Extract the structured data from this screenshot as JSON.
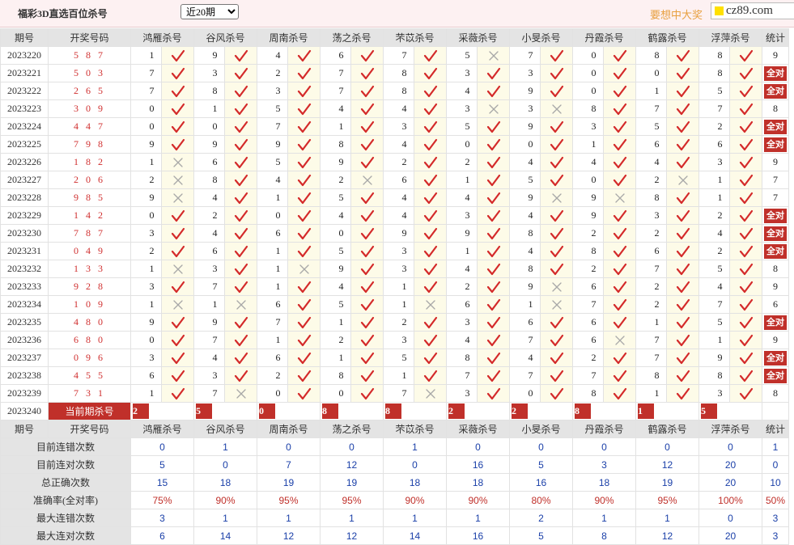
{
  "header": {
    "title": "福彩3D直选百位杀号",
    "period_selected": "近20期",
    "period_options": [
      "近20期"
    ],
    "slogan": "要想中大奖",
    "site": "cz89.com"
  },
  "table": {
    "col_issue": "期号",
    "col_draw": "开奖号码",
    "col_stat": "统计",
    "experts": [
      "鸿雁杀号",
      "谷风杀号",
      "周南杀号",
      "荡之杀号",
      "芣苡杀号",
      "采薇杀号",
      "小旻杀号",
      "丹霞杀号",
      "鹤露杀号",
      "浮萍杀号"
    ],
    "all_correct_text": "全对",
    "rows": [
      {
        "issue": "2023220",
        "draw": "587",
        "cells": [
          [
            1,
            1
          ],
          [
            9,
            1
          ],
          [
            4,
            1
          ],
          [
            6,
            1
          ],
          [
            7,
            1
          ],
          [
            5,
            0
          ],
          [
            7,
            1
          ],
          [
            0,
            1
          ],
          [
            8,
            1
          ],
          [
            8,
            1
          ]
        ],
        "stat": "9"
      },
      {
        "issue": "2023221",
        "draw": "503",
        "cells": [
          [
            7,
            1
          ],
          [
            3,
            1
          ],
          [
            2,
            1
          ],
          [
            7,
            1
          ],
          [
            8,
            1
          ],
          [
            3,
            1
          ],
          [
            3,
            1
          ],
          [
            0,
            1
          ],
          [
            0,
            1
          ],
          [
            8,
            1
          ]
        ],
        "stat": "全对"
      },
      {
        "issue": "2023222",
        "draw": "265",
        "cells": [
          [
            7,
            1
          ],
          [
            8,
            1
          ],
          [
            3,
            1
          ],
          [
            7,
            1
          ],
          [
            8,
            1
          ],
          [
            4,
            1
          ],
          [
            9,
            1
          ],
          [
            0,
            1
          ],
          [
            1,
            1
          ],
          [
            5,
            1
          ]
        ],
        "stat": "全对"
      },
      {
        "issue": "2023223",
        "draw": "309",
        "cells": [
          [
            0,
            1
          ],
          [
            1,
            1
          ],
          [
            5,
            1
          ],
          [
            4,
            1
          ],
          [
            4,
            1
          ],
          [
            3,
            0
          ],
          [
            3,
            0
          ],
          [
            8,
            1
          ],
          [
            7,
            1
          ],
          [
            7,
            1
          ]
        ],
        "stat": "8"
      },
      {
        "issue": "2023224",
        "draw": "447",
        "cells": [
          [
            0,
            1
          ],
          [
            0,
            1
          ],
          [
            7,
            1
          ],
          [
            1,
            1
          ],
          [
            3,
            1
          ],
          [
            5,
            1
          ],
          [
            9,
            1
          ],
          [
            3,
            1
          ],
          [
            5,
            1
          ],
          [
            2,
            1
          ]
        ],
        "stat": "全对"
      },
      {
        "issue": "2023225",
        "draw": "798",
        "cells": [
          [
            9,
            1
          ],
          [
            9,
            1
          ],
          [
            9,
            1
          ],
          [
            8,
            1
          ],
          [
            4,
            1
          ],
          [
            0,
            1
          ],
          [
            0,
            1
          ],
          [
            1,
            1
          ],
          [
            6,
            1
          ],
          [
            6,
            1
          ]
        ],
        "stat": "全对"
      },
      {
        "issue": "2023226",
        "draw": "182",
        "cells": [
          [
            1,
            0
          ],
          [
            6,
            1
          ],
          [
            5,
            1
          ],
          [
            9,
            1
          ],
          [
            2,
            1
          ],
          [
            2,
            1
          ],
          [
            4,
            1
          ],
          [
            4,
            1
          ],
          [
            4,
            1
          ],
          [
            3,
            1
          ]
        ],
        "stat": "9"
      },
      {
        "issue": "2023227",
        "draw": "206",
        "cells": [
          [
            2,
            0
          ],
          [
            8,
            1
          ],
          [
            4,
            1
          ],
          [
            2,
            0
          ],
          [
            6,
            1
          ],
          [
            1,
            1
          ],
          [
            5,
            1
          ],
          [
            0,
            1
          ],
          [
            2,
            0
          ],
          [
            1,
            1
          ]
        ],
        "stat": "7"
      },
      {
        "issue": "2023228",
        "draw": "985",
        "cells": [
          [
            9,
            0
          ],
          [
            4,
            1
          ],
          [
            1,
            1
          ],
          [
            5,
            1
          ],
          [
            4,
            1
          ],
          [
            4,
            1
          ],
          [
            9,
            0
          ],
          [
            9,
            0
          ],
          [
            8,
            1
          ],
          [
            1,
            1
          ]
        ],
        "stat": "7"
      },
      {
        "issue": "2023229",
        "draw": "142",
        "cells": [
          [
            0,
            1
          ],
          [
            2,
            1
          ],
          [
            0,
            1
          ],
          [
            4,
            1
          ],
          [
            4,
            1
          ],
          [
            3,
            1
          ],
          [
            4,
            1
          ],
          [
            9,
            1
          ],
          [
            3,
            1
          ],
          [
            2,
            1
          ]
        ],
        "stat": "全对"
      },
      {
        "issue": "2023230",
        "draw": "787",
        "cells": [
          [
            3,
            1
          ],
          [
            4,
            1
          ],
          [
            6,
            1
          ],
          [
            0,
            1
          ],
          [
            9,
            1
          ],
          [
            9,
            1
          ],
          [
            8,
            1
          ],
          [
            2,
            1
          ],
          [
            2,
            1
          ],
          [
            4,
            1
          ]
        ],
        "stat": "全对"
      },
      {
        "issue": "2023231",
        "draw": "049",
        "cells": [
          [
            2,
            1
          ],
          [
            6,
            1
          ],
          [
            1,
            1
          ],
          [
            5,
            1
          ],
          [
            3,
            1
          ],
          [
            1,
            1
          ],
          [
            4,
            1
          ],
          [
            8,
            1
          ],
          [
            6,
            1
          ],
          [
            2,
            1
          ]
        ],
        "stat": "全对"
      },
      {
        "issue": "2023232",
        "draw": "133",
        "cells": [
          [
            1,
            0
          ],
          [
            3,
            1
          ],
          [
            1,
            0
          ],
          [
            9,
            1
          ],
          [
            3,
            1
          ],
          [
            4,
            1
          ],
          [
            8,
            1
          ],
          [
            2,
            1
          ],
          [
            7,
            1
          ],
          [
            5,
            1
          ]
        ],
        "stat": "8"
      },
      {
        "issue": "2023233",
        "draw": "928",
        "cells": [
          [
            3,
            1
          ],
          [
            7,
            1
          ],
          [
            1,
            1
          ],
          [
            4,
            1
          ],
          [
            1,
            1
          ],
          [
            2,
            1
          ],
          [
            9,
            0
          ],
          [
            6,
            1
          ],
          [
            2,
            1
          ],
          [
            4,
            1
          ]
        ],
        "stat": "9"
      },
      {
        "issue": "2023234",
        "draw": "109",
        "cells": [
          [
            1,
            0
          ],
          [
            1,
            0
          ],
          [
            6,
            1
          ],
          [
            5,
            1
          ],
          [
            1,
            0
          ],
          [
            6,
            1
          ],
          [
            1,
            0
          ],
          [
            7,
            1
          ],
          [
            2,
            1
          ],
          [
            7,
            1
          ]
        ],
        "stat": "6"
      },
      {
        "issue": "2023235",
        "draw": "480",
        "cells": [
          [
            9,
            1
          ],
          [
            9,
            1
          ],
          [
            7,
            1
          ],
          [
            1,
            1
          ],
          [
            2,
            1
          ],
          [
            3,
            1
          ],
          [
            6,
            1
          ],
          [
            6,
            1
          ],
          [
            1,
            1
          ],
          [
            5,
            1
          ]
        ],
        "stat": "全对"
      },
      {
        "issue": "2023236",
        "draw": "680",
        "cells": [
          [
            0,
            1
          ],
          [
            7,
            1
          ],
          [
            1,
            1
          ],
          [
            2,
            1
          ],
          [
            3,
            1
          ],
          [
            4,
            1
          ],
          [
            7,
            1
          ],
          [
            6,
            0
          ],
          [
            7,
            1
          ],
          [
            1,
            1
          ]
        ],
        "stat": "9"
      },
      {
        "issue": "2023237",
        "draw": "096",
        "cells": [
          [
            3,
            1
          ],
          [
            4,
            1
          ],
          [
            6,
            1
          ],
          [
            1,
            1
          ],
          [
            5,
            1
          ],
          [
            8,
            1
          ],
          [
            4,
            1
          ],
          [
            2,
            1
          ],
          [
            7,
            1
          ],
          [
            9,
            1
          ]
        ],
        "stat": "全对"
      },
      {
        "issue": "2023238",
        "draw": "455",
        "cells": [
          [
            6,
            1
          ],
          [
            3,
            1
          ],
          [
            2,
            1
          ],
          [
            8,
            1
          ],
          [
            1,
            1
          ],
          [
            7,
            1
          ],
          [
            7,
            1
          ],
          [
            7,
            1
          ],
          [
            8,
            1
          ],
          [
            8,
            1
          ]
        ],
        "stat": "全对"
      },
      {
        "issue": "2023239",
        "draw": "731",
        "cells": [
          [
            1,
            1
          ],
          [
            7,
            0
          ],
          [
            0,
            1
          ],
          [
            0,
            1
          ],
          [
            7,
            0
          ],
          [
            3,
            1
          ],
          [
            0,
            1
          ],
          [
            8,
            1
          ],
          [
            1,
            1
          ],
          [
            3,
            1
          ]
        ],
        "stat": "8"
      }
    ],
    "current": {
      "issue": "2023240",
      "label": "当前期杀号",
      "preds": [
        "2",
        "5",
        "0",
        "8",
        "8",
        "2",
        "2",
        "8",
        "1",
        "5"
      ]
    }
  },
  "stats": {
    "rows": [
      {
        "label": "目前连错次数",
        "values": [
          "0",
          "1",
          "0",
          "0",
          "1",
          "0",
          "0",
          "0",
          "0",
          "0",
          "1"
        ]
      },
      {
        "label": "目前连对次数",
        "values": [
          "5",
          "0",
          "7",
          "12",
          "0",
          "16",
          "5",
          "3",
          "12",
          "20",
          "0"
        ]
      },
      {
        "label": "总正确次数",
        "values": [
          "15",
          "18",
          "19",
          "19",
          "18",
          "18",
          "16",
          "18",
          "19",
          "20",
          "10"
        ]
      },
      {
        "label": "准确率(全对率)",
        "values": [
          "75%",
          "90%",
          "95%",
          "95%",
          "90%",
          "90%",
          "80%",
          "90%",
          "95%",
          "100%",
          "50%"
        ],
        "rate": true
      },
      {
        "label": "最大连错次数",
        "values": [
          "3",
          "1",
          "1",
          "1",
          "1",
          "1",
          "2",
          "1",
          "1",
          "0",
          "3"
        ]
      },
      {
        "label": "最大连对次数",
        "values": [
          "6",
          "14",
          "12",
          "12",
          "14",
          "16",
          "5",
          "8",
          "12",
          "20",
          "3"
        ]
      }
    ]
  },
  "colors": {
    "correct": "#d42a2a",
    "wrong": "#a8a8a8",
    "accent": "#c0302a",
    "stat_blue": "#1a3fa8"
  },
  "icons": {
    "correct": "check-icon",
    "wrong": "cross-icon"
  }
}
